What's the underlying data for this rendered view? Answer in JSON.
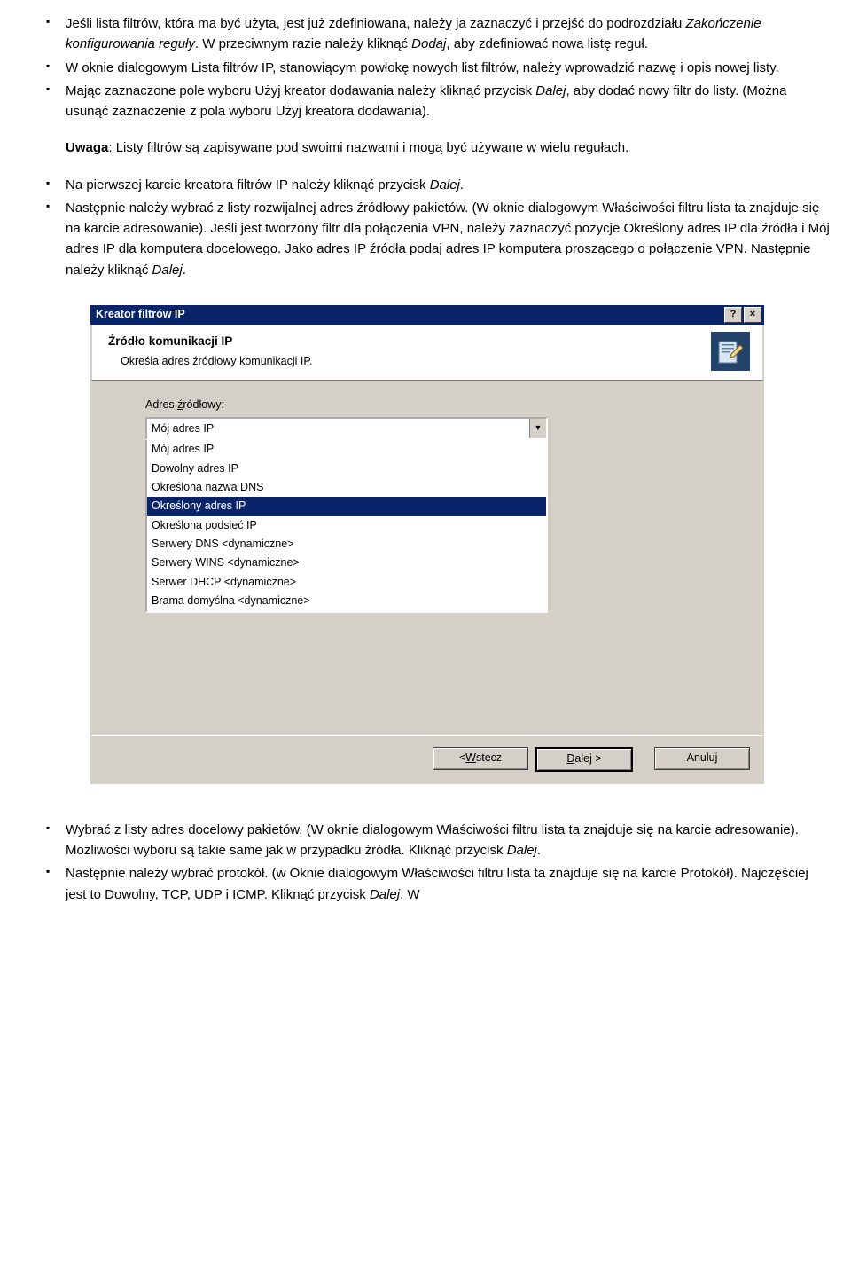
{
  "bullets1": [
    "Jeśli lista filtrów, która ma być użyta, jest już zdefiniowana, należy ja zaznaczyć i przejść do podrozdziału <span class=\"italic\">Zakończenie konfigurowania reguły</span>. W przeciwnym razie należy kliknąć <span class=\"italic\">Dodaj</span>, aby zdefiniować nowa listę reguł.",
    "W oknie dialogowym Lista filtrów IP, stanowiącym powłokę nowych list filtrów, należy wprowadzić nazwę i opis nowej listy.",
    "Mając zaznaczone pole wyboru Użyj kreator dodawania należy kliknąć przycisk <span class=\"italic\">Dalej</span>, aby dodać nowy filtr do listy. (Można usunąć zaznaczenie z pola wyboru Użyj kreatora dodawania)."
  ],
  "note": "<span class=\"bold\">Uwaga</span>: Listy filtrów są zapisywane pod swoimi nazwami i mogą być używane w wielu regułach.",
  "bullets2": [
    "Na pierwszej karcie kreatora filtrów IP należy kliknąć przycisk <span class=\"italic\">Dalej</span>.",
    "Następnie należy wybrać z listy rozwijalnej adres źródłowy pakietów. (W oknie dialogowym Właściwości filtru lista ta znajduje się na karcie adresowanie). Jeśli jest tworzony filtr dla połączenia VPN, należy zaznaczyć pozycje Określony adres IP dla źródła i Mój adres IP dla komputera docelowego. Jako adres IP źródła podaj adres IP komputera proszącego o połączenie VPN. Następnie należy kliknąć <span class=\"italic\">Dalej</span>."
  ],
  "dialog": {
    "title": "Kreator filtrów IP",
    "helpBtn": "?",
    "closeBtn": "×",
    "headerTitle": "Źródło komunikacji IP",
    "headerSub": "Określa adres źródłowy komunikacji IP.",
    "fieldLabelPrefix": "Adres ",
    "fieldLabelUnderlined": "ź",
    "fieldLabelSuffix": "ródłowy:",
    "selected": "Mój adres IP",
    "items": [
      "Mój adres IP",
      "Dowolny adres IP",
      "Określona nazwa DNS",
      "Określony adres IP",
      "Określona podsieć IP",
      "Serwery DNS <dynamiczne>",
      "Serwery WINS <dynamiczne>",
      "Serwer DHCP <dynamiczne>",
      "Brama domyślna <dynamiczne>"
    ],
    "selectedIndex": 3,
    "backPrefix": "< ",
    "backU": "W",
    "backSuffix": "stecz",
    "nextU": "D",
    "nextSuffix": "alej >",
    "cancel": "Anuluj"
  },
  "bullets3": [
    "Wybrać z listy adres docelowy pakietów. (W oknie dialogowym Właściwości filtru lista ta znajduje się na karcie adresowanie). Możliwości wyboru są takie same jak w przypadku źródła. Kliknąć przycisk <span class=\"italic\">Dalej</span>.",
    "Następnie należy wybrać protokół. (w Oknie dialogowym Właściwości filtru lista ta znajduje się na karcie Protokół). Najczęściej jest to Dowolny, TCP, UDP i ICMP. Kliknąć przycisk <span class=\"italic\">Dalej</span>. W"
  ]
}
